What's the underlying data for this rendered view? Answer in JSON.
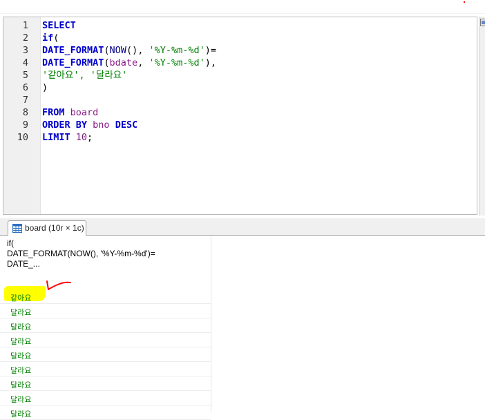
{
  "editor": {
    "lines": [
      {
        "num": "1",
        "tokens": [
          {
            "t": "SELECT",
            "c": "kw"
          }
        ]
      },
      {
        "num": "2",
        "tokens": [
          {
            "t": "if",
            "c": "kw"
          },
          {
            "t": "(",
            "c": "plain"
          }
        ]
      },
      {
        "num": "3",
        "tokens": [
          {
            "t": "DATE_FORMAT",
            "c": "kw"
          },
          {
            "t": "(",
            "c": "plain"
          },
          {
            "t": "NOW",
            "c": "fn"
          },
          {
            "t": "(), ",
            "c": "plain"
          },
          {
            "t": "'%Y-%m-%d'",
            "c": "str"
          },
          {
            "t": ")=",
            "c": "plain"
          }
        ]
      },
      {
        "num": "4",
        "tokens": [
          {
            "t": "DATE_FORMAT",
            "c": "kw"
          },
          {
            "t": "(",
            "c": "plain"
          },
          {
            "t": "bdate",
            "c": "ident"
          },
          {
            "t": ", ",
            "c": "plain"
          },
          {
            "t": "'%Y-%m-%d'",
            "c": "str"
          },
          {
            "t": "),",
            "c": "plain"
          }
        ]
      },
      {
        "num": "5",
        "tokens": [
          {
            "t": "'같아요', '달라요'",
            "c": "str"
          }
        ]
      },
      {
        "num": "6",
        "tokens": [
          {
            "t": ")",
            "c": "plain"
          }
        ]
      },
      {
        "num": "7",
        "tokens": []
      },
      {
        "num": "8",
        "tokens": [
          {
            "t": "FROM",
            "c": "kw"
          },
          {
            "t": " ",
            "c": "plain"
          },
          {
            "t": "board",
            "c": "ident"
          }
        ]
      },
      {
        "num": "9",
        "tokens": [
          {
            "t": "ORDER BY",
            "c": "kw"
          },
          {
            "t": " ",
            "c": "plain"
          },
          {
            "t": "bno",
            "c": "ident"
          },
          {
            "t": " ",
            "c": "plain"
          },
          {
            "t": "DESC",
            "c": "kw"
          }
        ]
      },
      {
        "num": "10",
        "tokens": [
          {
            "t": "LIMIT",
            "c": "kw"
          },
          {
            "t": " ",
            "c": "plain"
          },
          {
            "t": "10",
            "c": "num"
          },
          {
            "t": ";",
            "c": "plain"
          }
        ]
      }
    ]
  },
  "result_tab": {
    "label": "board (10r × 1c)",
    "icon": "table-grid-icon"
  },
  "results": {
    "column_header": "if(\nDATE_FORMAT(NOW(), '%Y-%m-%d')=\nDATE_...",
    "rows": [
      "같아요",
      "달라요",
      "달라요",
      "달라요",
      "달라요",
      "달라요",
      "달라요",
      "달라요",
      "달라요"
    ]
  },
  "annotation": {
    "highlight_color": "#ffff00",
    "mark_color": "#ff0000"
  },
  "colors": {
    "keyword": "#0000cc",
    "string": "#008000",
    "identifier": "#8b1a8b",
    "number": "#7a1a7a",
    "result_text": "#008000"
  }
}
